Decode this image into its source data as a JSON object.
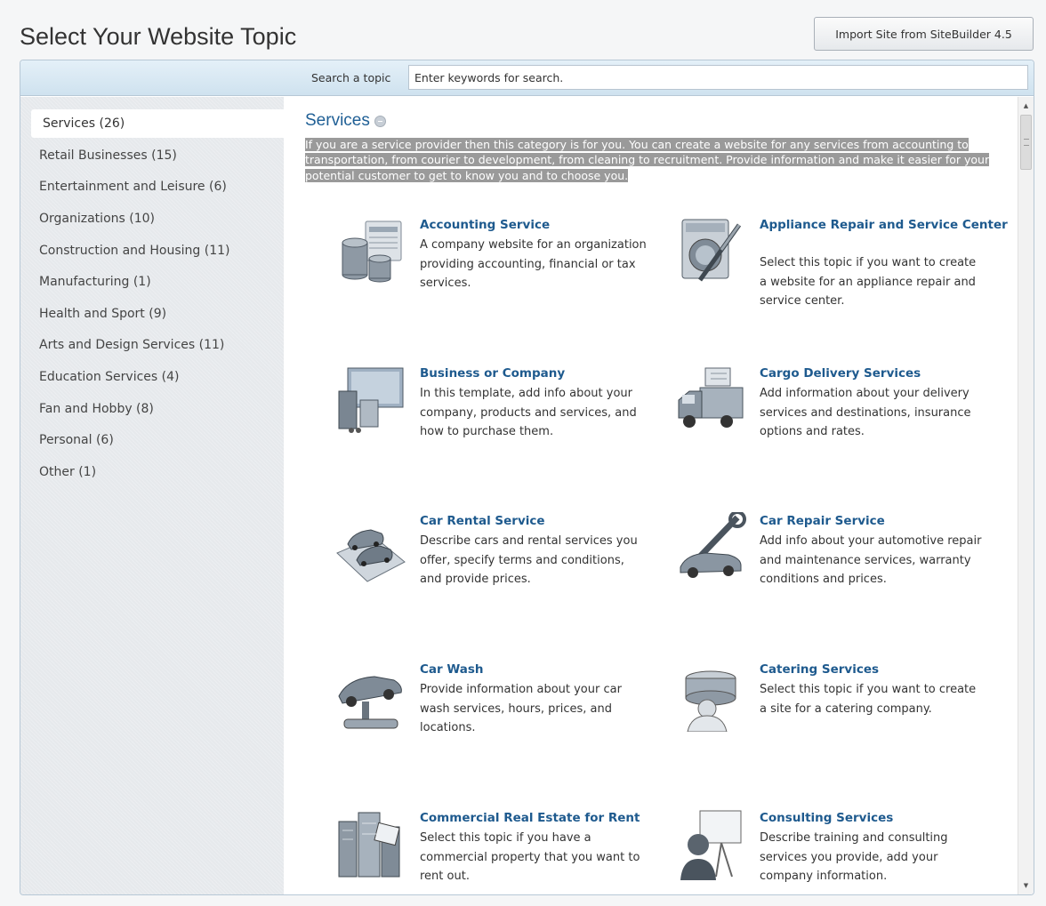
{
  "page": {
    "title": "Select Your Website Topic",
    "import_label": "Import Site from SiteBuilder 4.5"
  },
  "search": {
    "label": "Search a topic",
    "placeholder": "Enter keywords for search."
  },
  "sidebar": {
    "items": [
      {
        "label": "Services (26)"
      },
      {
        "label": "Retail Businesses (15)"
      },
      {
        "label": "Entertainment and Leisure (6)"
      },
      {
        "label": "Organizations (10)"
      },
      {
        "label": "Construction and Housing (11)"
      },
      {
        "label": "Manufacturing (1)"
      },
      {
        "label": "Health and Sport (9)"
      },
      {
        "label": "Arts and Design Services (11)"
      },
      {
        "label": "Education Services (4)"
      },
      {
        "label": "Fan and Hobby (8)"
      },
      {
        "label": "Personal (6)"
      },
      {
        "label": "Other (1)"
      }
    ]
  },
  "category": {
    "title": "Services",
    "description": "If you are a service provider then this category is for you. You can create a website for any services from accounting to transportation, from courier to development, from cleaning to recruitment. Provide information and make it easier for your potential customer to get to know you and to choose you."
  },
  "topics": [
    {
      "title": "Accounting Service",
      "desc": "A company website for an organization providing accounting, financial or tax services.",
      "icon": "coins-document-icon"
    },
    {
      "title": "Appliance Repair and Service Center",
      "desc": "Select this topic if you want to create a website for an appliance repair and service center.",
      "icon": "washing-machine-screwdriver-icon"
    },
    {
      "title": "Business or Company",
      "desc": "In this template, add info about your company, products and services, and how to purchase them.",
      "icon": "office-desk-icon"
    },
    {
      "title": "Cargo Delivery Services",
      "desc": "Add information about your delivery services and destinations, insurance options and rates.",
      "icon": "truck-icon"
    },
    {
      "title": "Car Rental Service",
      "desc": "Describe cars and rental services you offer, specify terms and conditions, and provide prices.",
      "icon": "cars-on-platform-icon"
    },
    {
      "title": "Car Repair Service",
      "desc": "Add info about your automotive repair and maintenance services, warranty conditions and prices.",
      "icon": "car-wrench-icon"
    },
    {
      "title": "Car Wash",
      "desc": "Provide information about your car wash services, hours, prices, and locations.",
      "icon": "car-wash-brush-icon"
    },
    {
      "title": "Catering Services",
      "desc": "Select this topic if you want to create a site for a catering company.",
      "icon": "chef-cake-icon"
    },
    {
      "title": "Commercial Real Estate for Rent",
      "desc": "Select this topic if you have a commercial property that you want to rent out.",
      "icon": "buildings-for-rent-icon"
    },
    {
      "title": "Consulting Services",
      "desc": "Describe training and consulting services you provide, add your company information.",
      "icon": "presenter-board-icon"
    }
  ]
}
